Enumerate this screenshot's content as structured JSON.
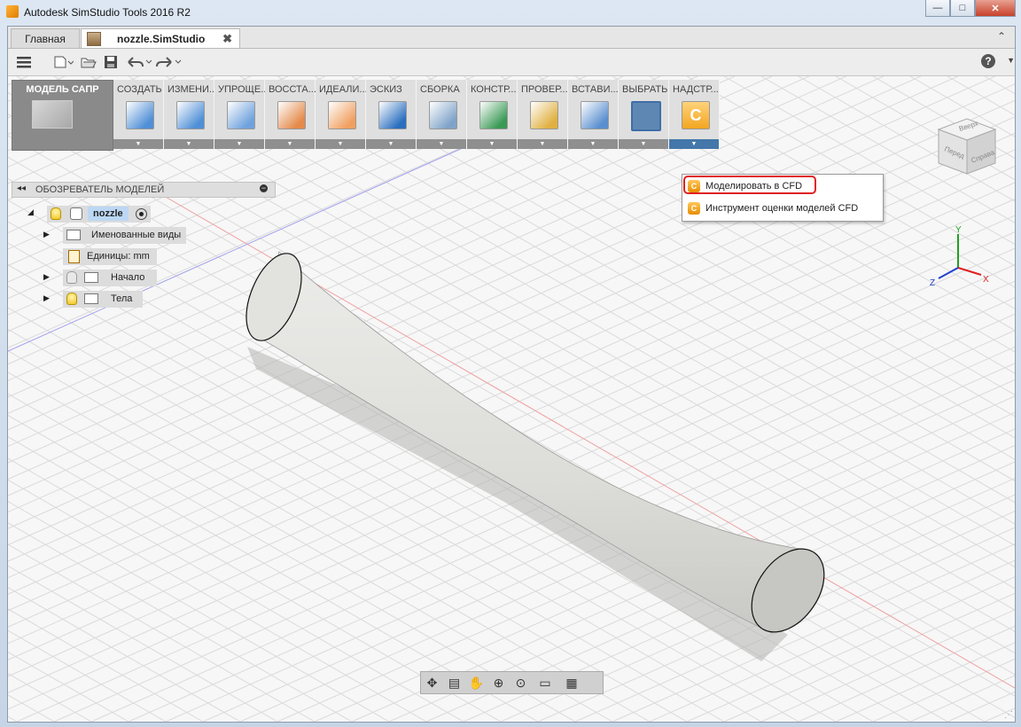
{
  "window": {
    "title": "Autodesk SimStudio Tools 2016 R2",
    "minimize_symbol": "—",
    "maximize_symbol": "□",
    "close_symbol": "✕"
  },
  "tabs": {
    "home_label": "Главная",
    "document_label": "nozzle.SimStudio",
    "close_symbol": "✖",
    "scroll_symbol": "⌃"
  },
  "quick_access": {
    "menu_icon": "hamburger-icon",
    "new_icon": "new-file-icon",
    "open_icon": "folder-open-icon",
    "save_icon": "save-icon",
    "undo_icon": "undo-icon",
    "redo_icon": "redo-icon",
    "help_label": "?"
  },
  "ribbon": {
    "mode_label": "МОДЕЛЬ САПР",
    "groups": [
      {
        "label": "СОЗДАТЬ",
        "icon": "create-box-icon",
        "color": "#4f8fd6"
      },
      {
        "label": "ИЗМЕНИ...",
        "icon": "modify-icon",
        "color": "#4f8fd6"
      },
      {
        "label": "УПРОЩЕ...",
        "icon": "simplify-icon",
        "color": "#6fa2dd"
      },
      {
        "label": "ВОССТА...",
        "icon": "restore-icon",
        "color": "#e48a4a"
      },
      {
        "label": "ИДЕАЛИ...",
        "icon": "idealize-icon",
        "color": "#f0a060"
      },
      {
        "label": "ЭСКИЗ",
        "icon": "sketch-icon",
        "color": "#2b6fbf"
      },
      {
        "label": "СБОРКА",
        "icon": "assembly-icon",
        "color": "#7fa3c8"
      },
      {
        "label": "КОНСТР...",
        "icon": "construct-icon",
        "color": "#3a9a55"
      },
      {
        "label": "ПРОВЕР...",
        "icon": "inspect-icon",
        "color": "#e0b040"
      },
      {
        "label": "ВСТАВИ...",
        "icon": "insert-icon",
        "color": "#5a8fcf"
      },
      {
        "label": "ВЫБРАТЬ",
        "icon": "select-icon",
        "color": "#3f6ea7"
      },
      {
        "label": "НАДСТР...",
        "icon": "addins-icon",
        "color": "#f2a620"
      }
    ]
  },
  "addins_menu": {
    "items": [
      {
        "label": "Моделировать в CFD",
        "icon": "cfd-icon"
      },
      {
        "label": "Инструмент оценки моделей CFD",
        "icon": "cfd-icon"
      }
    ]
  },
  "browser": {
    "title": "ОБОЗРЕВАТЕЛЬ МОДЕЛЕЙ",
    "collapse_symbol": "◂◂",
    "minimize_symbol": "−",
    "root": "nozzle",
    "items": [
      {
        "label": "Именованные виды"
      },
      {
        "label": "Единицы: mm"
      },
      {
        "label": "Начало"
      },
      {
        "label": "Тела"
      }
    ]
  },
  "viewcube": {
    "top": "Вверх",
    "front": "Перед",
    "right": "Справа"
  },
  "axes": {
    "x": "X",
    "y": "Y",
    "z": "Z",
    "x_color": "#e02020",
    "y_color": "#20a020",
    "z_color": "#2040d0"
  },
  "navbar": {
    "icons": [
      "orbit-icon",
      "look-at-icon",
      "pan-icon",
      "zoom-window-icon",
      "zoom-fit-icon",
      "display-settings-icon",
      "grid-icon"
    ]
  }
}
